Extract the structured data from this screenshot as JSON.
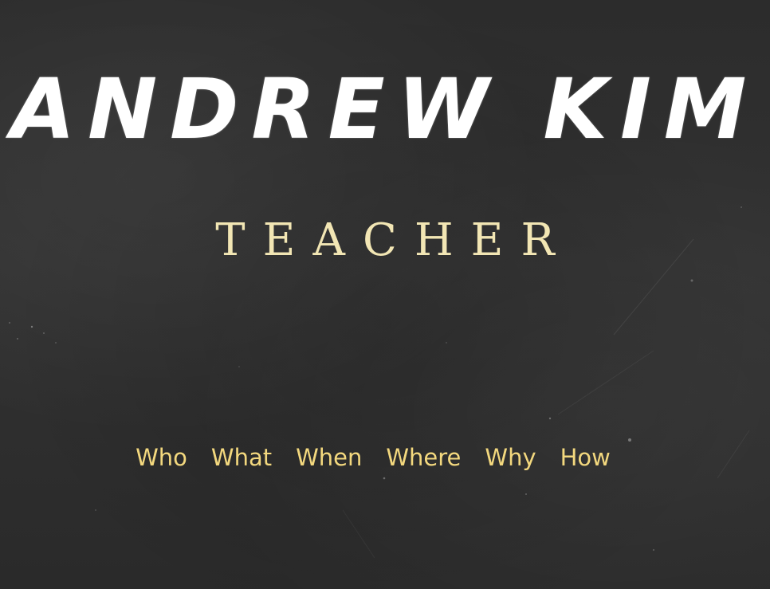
{
  "hero": {
    "title": "ANDREW KIM",
    "subtitle": "TEACHER"
  },
  "nav": {
    "items": [
      {
        "label": "Who"
      },
      {
        "label": "What"
      },
      {
        "label": "When"
      },
      {
        "label": "Where"
      },
      {
        "label": "Why"
      },
      {
        "label": "How"
      }
    ]
  },
  "colors": {
    "background": "#2f2f2f",
    "title": "#ffffff",
    "subtitle": "#f2e6b4",
    "nav_link": "#f3d87e"
  }
}
